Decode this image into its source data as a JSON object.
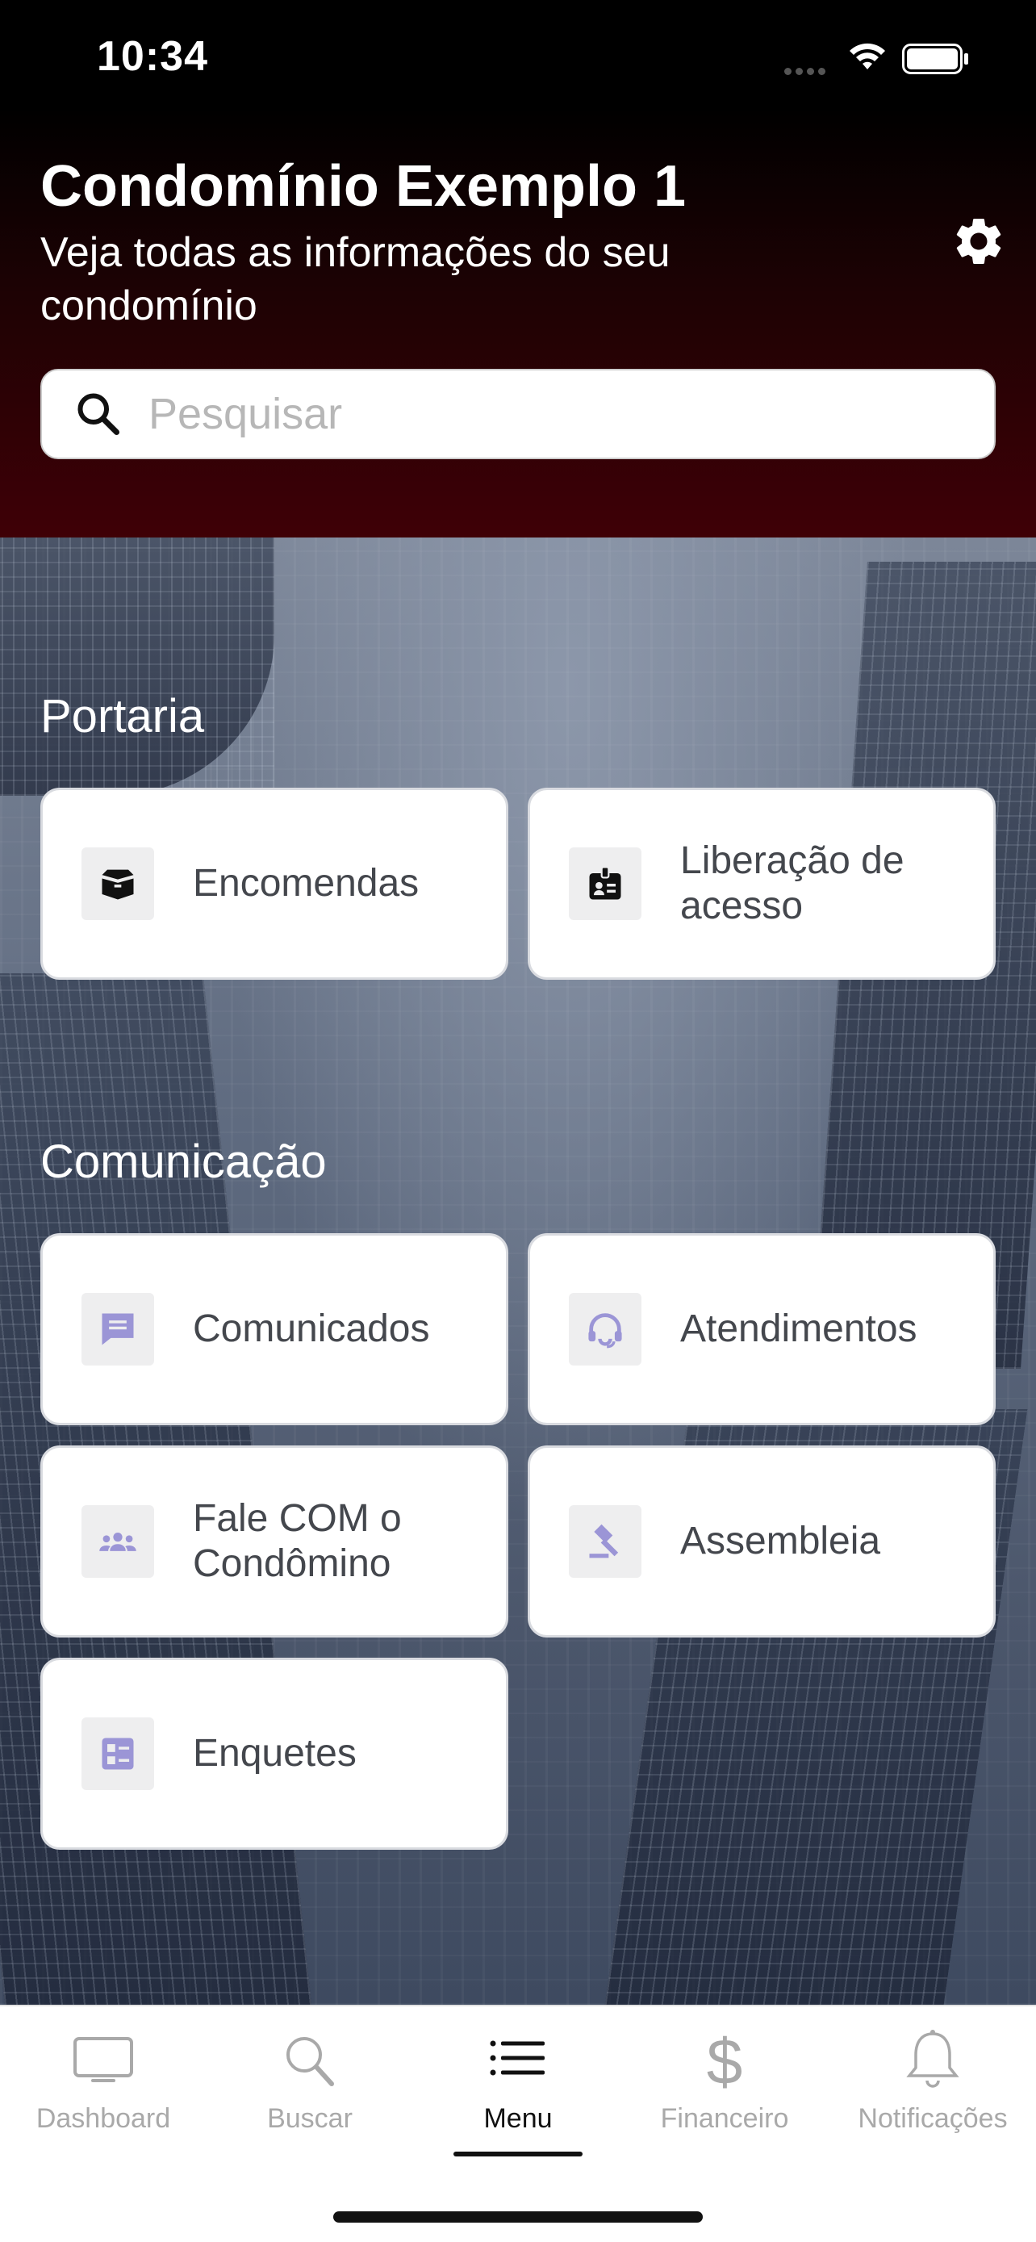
{
  "status_bar": {
    "time": "10:34"
  },
  "header": {
    "title": "Condomínio Exemplo 1",
    "subtitle": "Veja todas as informações do seu condomínio",
    "gradient_colors": [
      "#000000",
      "#3f0006"
    ]
  },
  "search": {
    "placeholder": "Pesquisar",
    "value": ""
  },
  "sections": [
    {
      "title": "Portaria",
      "items": [
        {
          "label": "Encomendas",
          "icon": "package-box-icon"
        },
        {
          "label": "Liberação de acesso",
          "icon": "id-badge-icon"
        }
      ]
    },
    {
      "title": "Comunicação",
      "items": [
        {
          "label": "Comunicados",
          "icon": "message-bubble-icon"
        },
        {
          "label": "Atendimentos",
          "icon": "headset-icon"
        },
        {
          "label": "Fale COM o Condômino",
          "icon": "people-group-icon"
        },
        {
          "label": "Assembleia",
          "icon": "gavel-icon"
        },
        {
          "label": "Enquetes",
          "icon": "poll-list-icon"
        }
      ]
    }
  ],
  "tabbar": {
    "tabs": [
      {
        "label": "Dashboard",
        "icon": "monitor-icon"
      },
      {
        "label": "Buscar",
        "icon": "search-icon"
      },
      {
        "label": "Menu",
        "icon": "list-menu-icon",
        "active": true
      },
      {
        "label": "Financeiro",
        "icon": "dollar-icon"
      },
      {
        "label": "Notificações",
        "icon": "bell-icon"
      }
    ]
  },
  "colors": {
    "icon_accent": "#9b95d6",
    "tile_text": "#44474d",
    "inactive_tab": "#a9a9a9",
    "active_tab": "#111111"
  }
}
